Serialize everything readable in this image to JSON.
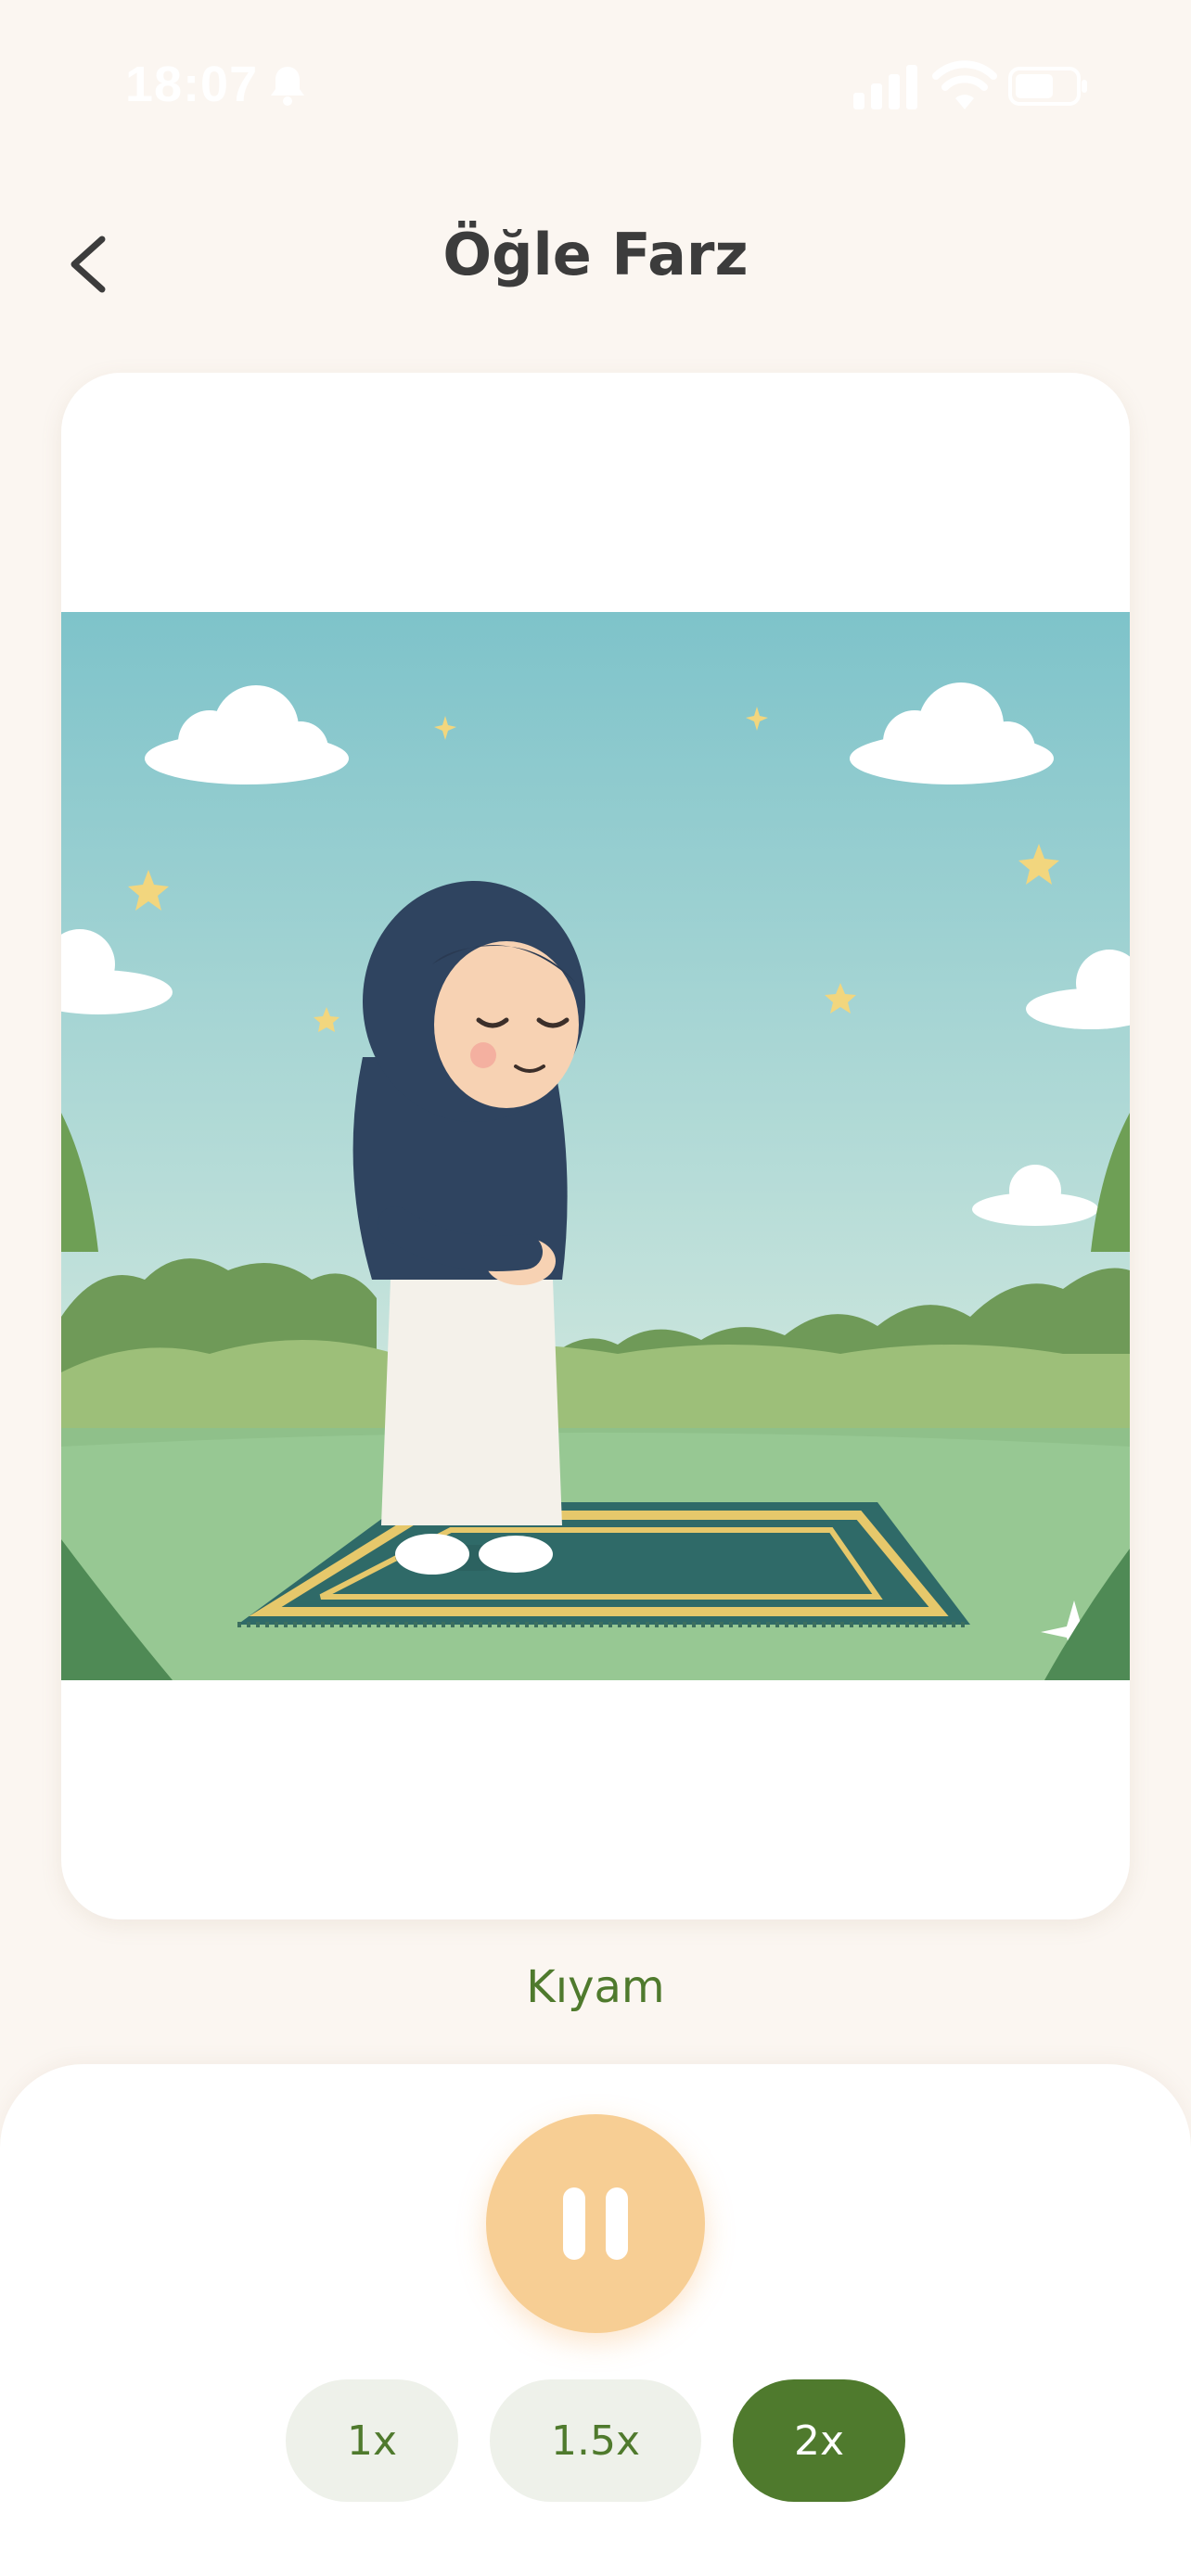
{
  "status_bar": {
    "time": "18:07",
    "icons": [
      "bell-icon",
      "signal-icon",
      "wifi-icon",
      "battery-icon"
    ]
  },
  "header": {
    "title": "Öğle Farz",
    "back_icon": "chevron-left-icon"
  },
  "illustration": {
    "subject": "girl-standing-in-prayer-on-prayer-rug"
  },
  "step": {
    "label": "Kıyam"
  },
  "controls": {
    "play_state_icon": "pause-icon",
    "speeds": [
      {
        "label": "1x",
        "active": false
      },
      {
        "label": "1.5x",
        "active": false
      },
      {
        "label": "2x",
        "active": true
      }
    ]
  },
  "colors": {
    "background": "#fbf6f1",
    "accent_green": "#4f7a2d",
    "play_button": "#f7ce94",
    "inactive_pill": "#eef1ea"
  }
}
